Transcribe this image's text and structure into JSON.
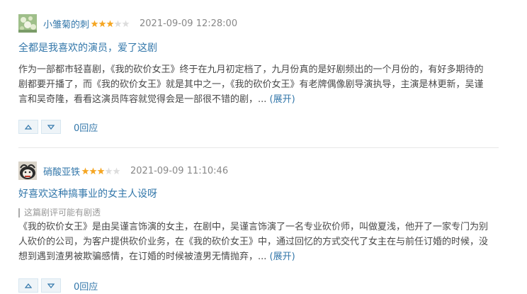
{
  "reviews": [
    {
      "username": "小雏菊的刺",
      "rating": 3,
      "max_rating": 5,
      "time": "2021-09-09 12:28:00",
      "title": "全都是我喜欢的演员，爱了这剧",
      "spoiler": "",
      "body_lines": [
        "作为一部都市轻喜剧，《我的砍价女王》终于在九月初定档了，九月份真的是好剧频出的一个月份的，有好多期待的",
        "剧都要开播了，而《我的砍价女王》就是其中之一，《我的砍价女王》有老牌偶像剧导演执导，主演是林更新，吴谨",
        "言和吴奇隆，看看这演员阵容就觉得会是一部很不错的剧，..."
      ],
      "expand_label": "(展开)",
      "reply_label": "0回应"
    },
    {
      "username": "硝酸亚铁",
      "rating": 3,
      "max_rating": 5,
      "time": "2021-09-09 11:10:46",
      "title": "好喜欢这种搞事业的女主人设呀",
      "spoiler": "这篇剧评可能有剧透",
      "body_lines": [
        "《我的砍价女王》是由吴谨言饰演的女主，在剧中，吴谨言饰演了一名专业砍价师，叫做夏浅，他开了一家专门为别",
        "人砍价的公司，为客户提供砍价业务，在《我的砍价女王》中，通过回忆的方式交代了女主在与前任订婚的时候，没",
        "想到遇到渣男被欺骗感情，在订婚的时候被渣男无情抛弃，..."
      ],
      "expand_label": "(展开)",
      "reply_label": "0回应"
    }
  ],
  "colors": {
    "link": "#3377aa",
    "star_on": "#f5a623",
    "star_off": "#dddddd",
    "body_text": "#494949",
    "meta_text": "#888888"
  },
  "icons": {
    "upvote": "triangle-up-icon",
    "downvote": "triangle-down-icon",
    "star": "star-icon"
  }
}
